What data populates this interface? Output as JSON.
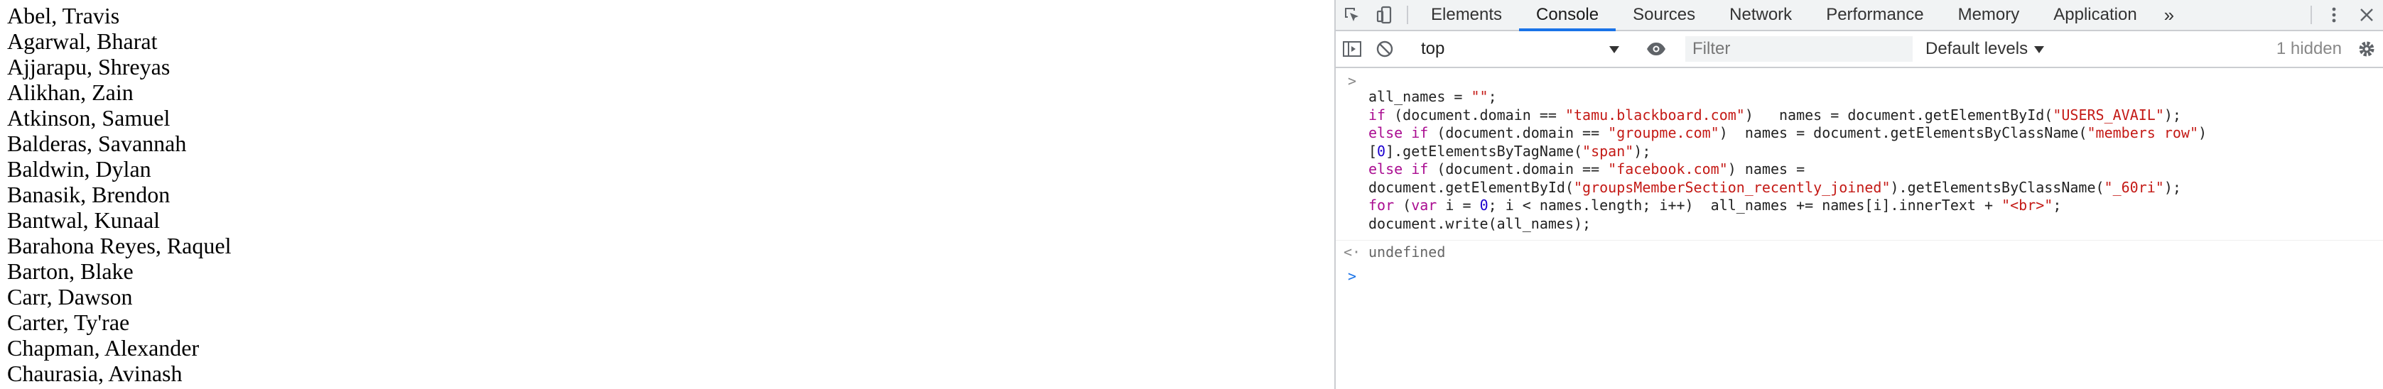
{
  "page": {
    "names": [
      "Abel, Travis",
      "Agarwal, Bharat",
      "Ajjarapu, Shreyas",
      "Alikhan, Zain",
      "Atkinson, Samuel",
      "Balderas, Savannah",
      "Baldwin, Dylan",
      "Banasik, Brendon",
      "Bantwal, Kunaal",
      "Barahona Reyes, Raquel",
      "Barton, Blake",
      "Carr, Dawson",
      "Carter, Ty'rae",
      "Chapman, Alexander",
      "Chaurasia, Avinash"
    ]
  },
  "devtools": {
    "tabs": [
      "Elements",
      "Console",
      "Sources",
      "Network",
      "Performance",
      "Memory",
      "Application"
    ],
    "active_tab": "Console",
    "more_tabs": "»",
    "toolbar": {
      "context": "top",
      "filter_placeholder": "Filter",
      "levels": "Default levels",
      "hidden": "1 hidden"
    },
    "console": {
      "input_prompt": ">",
      "output_prompt": "<·",
      "code": {
        "l1_a": "all_names = ",
        "l1_s": "\"\"",
        "l1_b": ";",
        "l2_kw": "if",
        "l2_a": " (document.domain == ",
        "l2_s1": "\"tamu.blackboard.com\"",
        "l2_b": ")   names = document.getElementById(",
        "l2_s2": "\"USERS_AVAIL\"",
        "l2_c": ");",
        "l3_kw": "else if",
        "l3_a": " (document.domain == ",
        "l3_s1": "\"groupme.com\"",
        "l3_b": ")  names = document.getElementsByClassName(",
        "l3_s2": "\"members row\"",
        "l3_c": ")",
        "l4_a": "[",
        "l4_n": "0",
        "l4_b": "].getElementsByTagName(",
        "l4_s": "\"span\"",
        "l4_c": ");",
        "l5_kw": "else if",
        "l5_a": " (document.domain == ",
        "l5_s": "\"facebook.com\"",
        "l5_b": ") names =",
        "l6_a": "document.getElementById(",
        "l6_s1": "\"groupsMemberSection_recently_joined\"",
        "l6_b": ").getElementsByClassName(",
        "l6_s2": "\"_60ri\"",
        "l6_c": ");",
        "l7_kw1": "for",
        "l7_a": " (",
        "l7_kw2": "var",
        "l7_b": " i = ",
        "l7_n": "0",
        "l7_c": "; i < names.length; i++)  all_names += names[i].innerText + ",
        "l7_s": "\"<br>\"",
        "l7_d": ";",
        "l8": "document.write(all_names);"
      },
      "result": "undefined"
    }
  }
}
